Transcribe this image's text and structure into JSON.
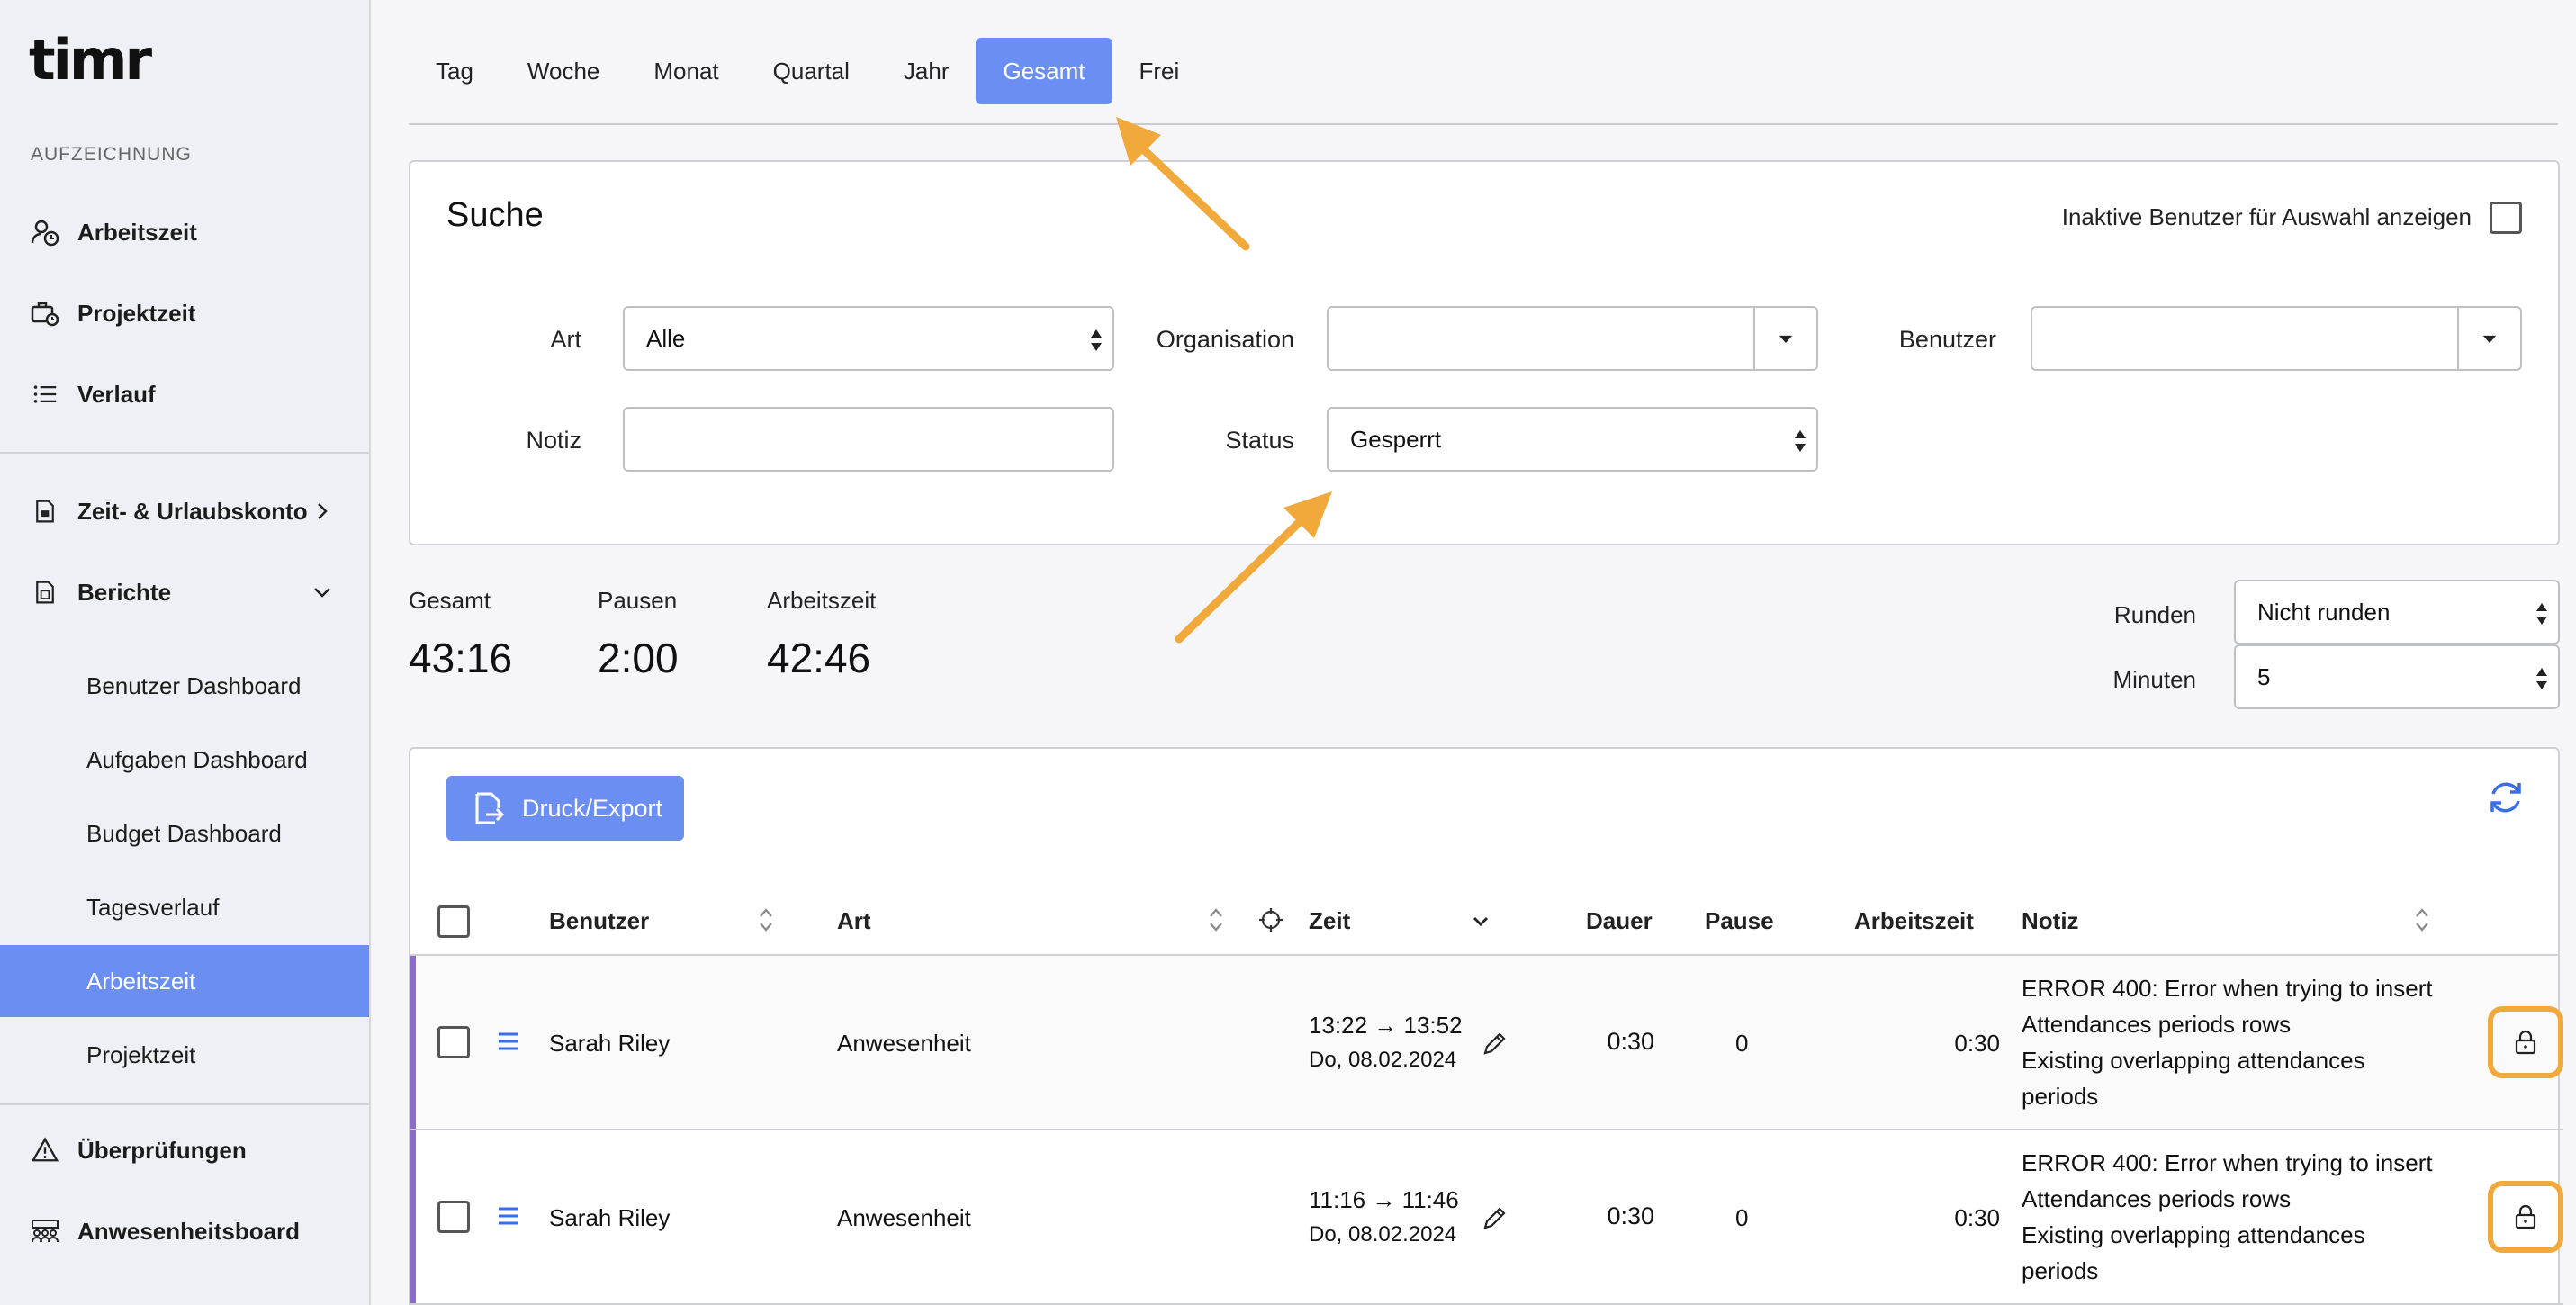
{
  "app": {
    "logo": "timr"
  },
  "sidebar": {
    "section_label": "AUFZEICHNUNG",
    "items": [
      {
        "label": "Arbeitszeit",
        "icon": "user-clock-icon"
      },
      {
        "label": "Projektzeit",
        "icon": "briefcase-clock-icon"
      },
      {
        "label": "Verlauf",
        "icon": "list-icon"
      },
      {
        "label": "Zeit- & Urlaubskonto",
        "icon": "document-icon"
      },
      {
        "label": "Berichte",
        "icon": "report-icon"
      },
      {
        "label": "Überprüfungen",
        "icon": "warning-icon"
      },
      {
        "label": "Anwesenheitsboard",
        "icon": "people-board-icon"
      }
    ],
    "reports": [
      {
        "label": "Benutzer Dashboard"
      },
      {
        "label": "Aufgaben Dashboard"
      },
      {
        "label": "Budget Dashboard"
      },
      {
        "label": "Tagesverlauf"
      },
      {
        "label": "Arbeitszeit",
        "active": true
      },
      {
        "label": "Projektzeit"
      }
    ]
  },
  "tabs": [
    {
      "label": "Tag"
    },
    {
      "label": "Woche"
    },
    {
      "label": "Monat"
    },
    {
      "label": "Quartal"
    },
    {
      "label": "Jahr"
    },
    {
      "label": "Gesamt",
      "active": true
    },
    {
      "label": "Frei"
    }
  ],
  "search": {
    "title": "Suche",
    "inactive_users_label": "Inaktive Benutzer für Auswahl anzeigen",
    "art_label": "Art",
    "art_value": "Alle",
    "organisation_label": "Organisation",
    "organisation_value": "",
    "benutzer_label": "Benutzer",
    "benutzer_value": "",
    "notiz_label": "Notiz",
    "notiz_value": "",
    "status_label": "Status",
    "status_value": "Gesperrt"
  },
  "totals": {
    "gesamt_label": "Gesamt",
    "gesamt_value": "43:16",
    "pausen_label": "Pausen",
    "pausen_value": "2:00",
    "arbeitszeit_label": "Arbeitszeit",
    "arbeitszeit_value": "42:46"
  },
  "rounding": {
    "runden_label": "Runden",
    "runden_value": "Nicht runden",
    "minuten_label": "Minuten",
    "minuten_value": "5"
  },
  "table": {
    "export_label": "Druck/Export",
    "columns": {
      "benutzer": "Benutzer",
      "art": "Art",
      "zeit": "Zeit",
      "dauer": "Dauer",
      "pause": "Pause",
      "arbeitszeit": "Arbeitszeit",
      "notiz": "Notiz"
    },
    "rows": [
      {
        "user": "Sarah Riley",
        "type": "Anwesenheit",
        "time_range": "13:22 → 13:52",
        "date": "Do, 08.02.2024",
        "duration": "0:30",
        "pause": "0",
        "worktime": "0:30",
        "note": [
          "ERROR 400: Error when trying to insert",
          "Attendances periods rows",
          "Existing overlapping attendances",
          "periods"
        ]
      },
      {
        "user": "Sarah Riley",
        "type": "Anwesenheit",
        "time_range": "11:16 → 11:46",
        "date": "Do, 08.02.2024",
        "duration": "0:30",
        "pause": "0",
        "worktime": "0:30",
        "note": [
          "ERROR 400: Error when trying to insert",
          "Attendances periods rows",
          "Existing overlapping attendances",
          "periods"
        ]
      }
    ]
  },
  "colors": {
    "accent": "#6b8ef3",
    "annotation": "#f0a93a",
    "row_marker": "#8b6cc7"
  }
}
